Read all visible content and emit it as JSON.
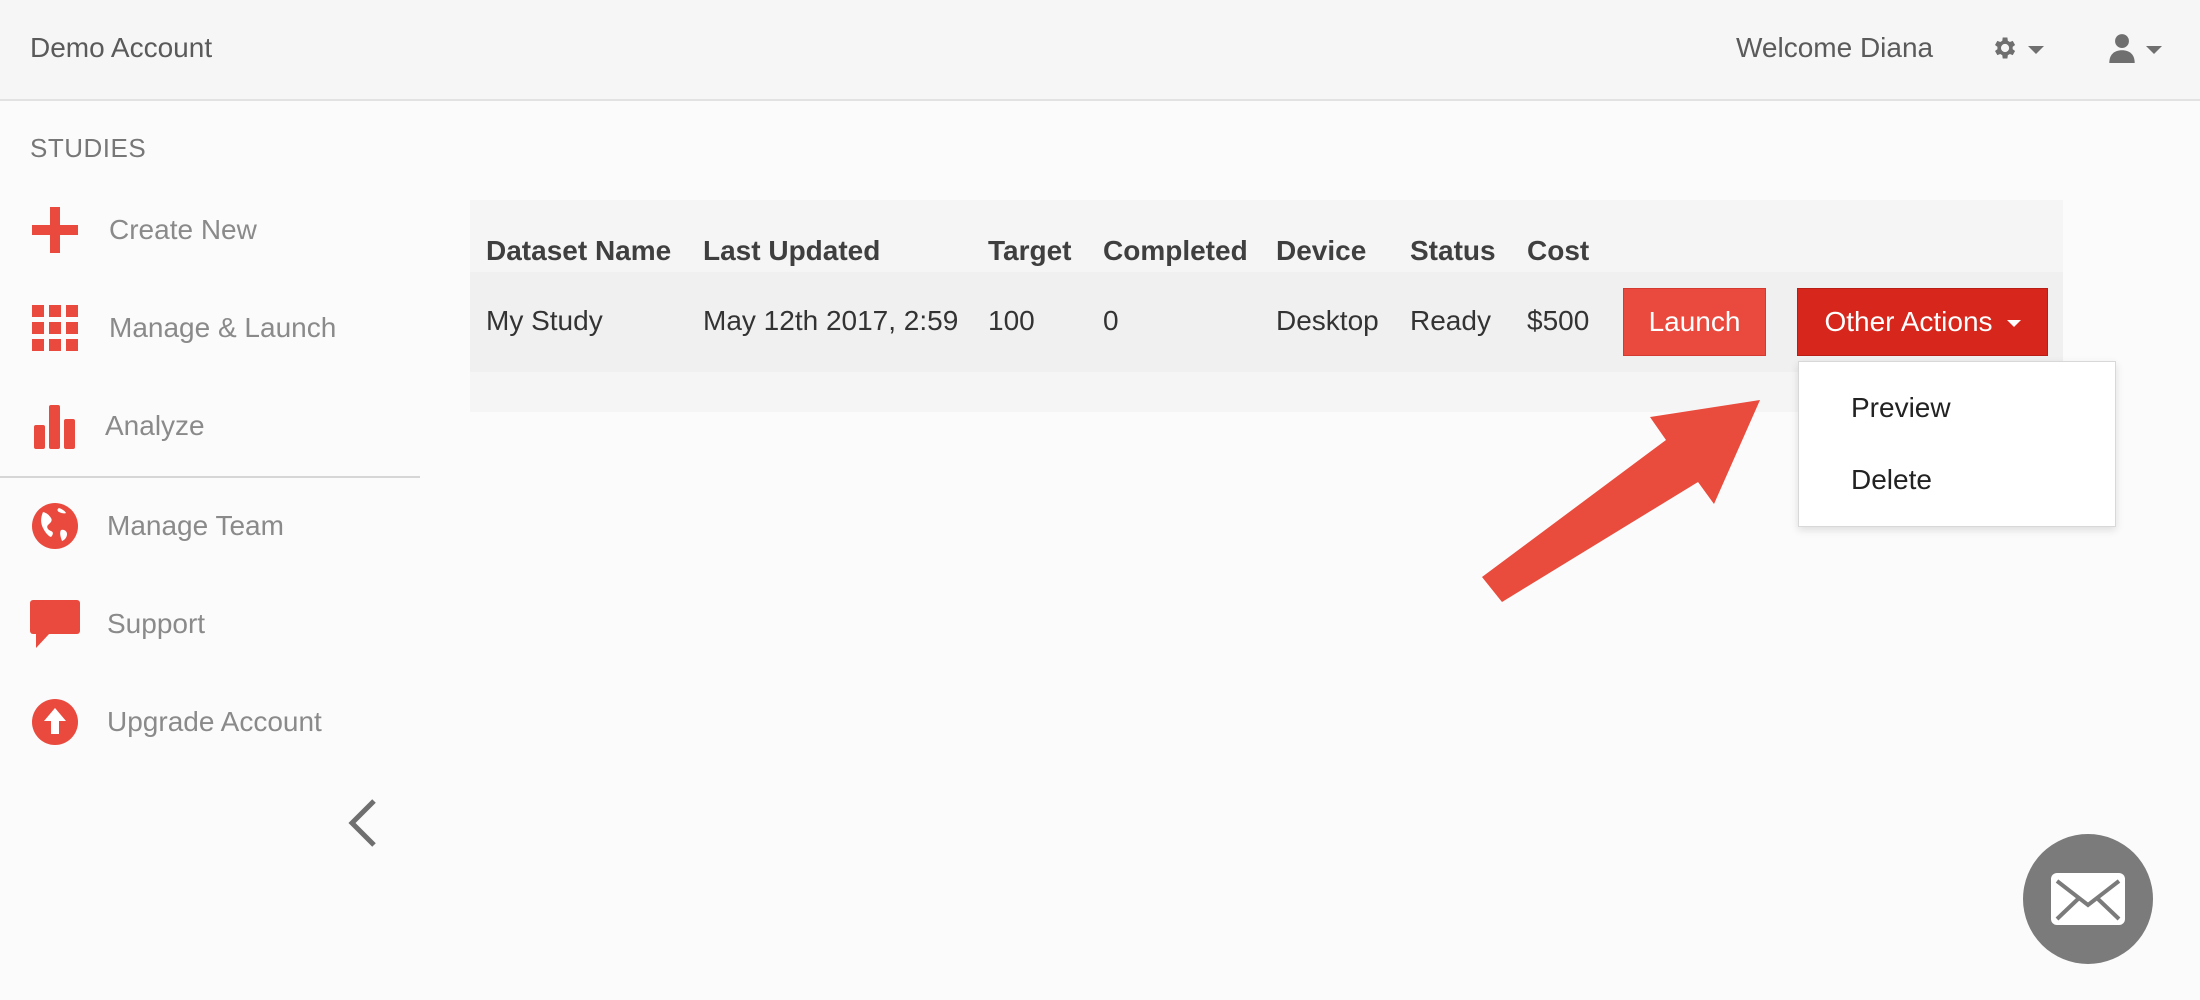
{
  "topbar": {
    "account_name": "Demo Account",
    "welcome_text": "Welcome Diana",
    "settings_icon": "gear-icon",
    "user_icon": "user-icon"
  },
  "sidebar": {
    "heading": "STUDIES",
    "items": [
      {
        "label": "Create New",
        "icon": "plus-icon"
      },
      {
        "label": "Manage & Launch",
        "icon": "grid-icon"
      },
      {
        "label": "Analyze",
        "icon": "bar-chart-icon"
      },
      {
        "label": "Manage Team",
        "icon": "globe-icon"
      },
      {
        "label": "Support",
        "icon": "speech-bubble-icon"
      },
      {
        "label": "Upgrade Account",
        "icon": "upload-arrow-icon"
      }
    ],
    "collapse_icon": "chevron-left-icon"
  },
  "table": {
    "headers": [
      "Dataset Name",
      "Last Updated",
      "Target",
      "Completed",
      "Device",
      "Status",
      "Cost"
    ],
    "rows": [
      {
        "dataset_name": "My Study",
        "last_updated": "May 12th 2017, 2:59",
        "target": "100",
        "completed": "0",
        "device": "Desktop",
        "status": "Ready",
        "cost": "$500",
        "launch_label": "Launch",
        "other_actions_label": "Other Actions"
      }
    ]
  },
  "dropdown": {
    "items": [
      "Preview",
      "Delete"
    ]
  },
  "colors": {
    "accent_red": "#ea4a3e",
    "dark_red": "#d7261c",
    "fab_gray": "#7b7b7b"
  },
  "fab_icon": "envelope-icon"
}
